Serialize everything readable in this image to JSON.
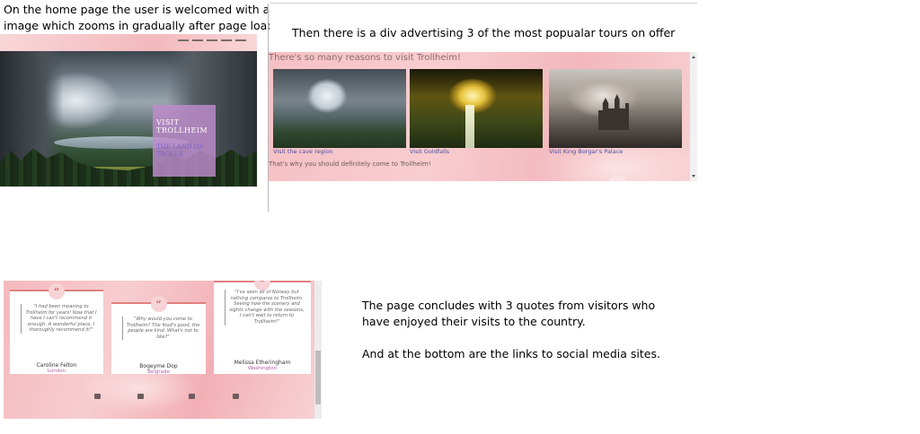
{
  "notes": {
    "home_line1": "On the home page the user is welcomed with a l",
    "home_line2": "image which zooms in gradually after page load.",
    "tours": "Then there is a div advertising 3 of the most popualar tours on offer",
    "quotes": "The page concludes with 3 quotes from visitors who have enjoyed their visits to the country.",
    "social": "And at the bottom are the links to social media sites."
  },
  "hero": {
    "cta_title": "VISIT TROLLHEIM",
    "cta_subtitle": "THE LAND OF TROLLS"
  },
  "tours": {
    "heading": "There's so many reasons to visit Trollheim!",
    "captions": [
      "Visit the cave region",
      "Visit Goldfalls",
      "Visit King Borgar's Palace"
    ],
    "footer": "That's why you should definitely come to Trollheim!"
  },
  "quotes": [
    {
      "text": "\"I had been meaning to Trollheim for years! Now that I have I can't recommend it enough. A wonderful place, I thoroughly recommend it!\"",
      "name": "Caroline Felton",
      "location": "London"
    },
    {
      "text": "\"Why would you come to Trollheim? The food's good, the people are kind. What's not to like?\"",
      "name": "Bogeyme Dop",
      "location": "Belgrade"
    },
    {
      "text": "\"I've seen all of Norway but nothing compares to Trollheim. Seeing how the scenery and sights change with the seasons, I can't wait to return to Trollheim!\"",
      "name": "Melissa Etheringham",
      "location": "Washington"
    }
  ],
  "social_icons": [
    "facebook-icon",
    "twitter-icon",
    "youtube-icon",
    "instagram-icon"
  ]
}
